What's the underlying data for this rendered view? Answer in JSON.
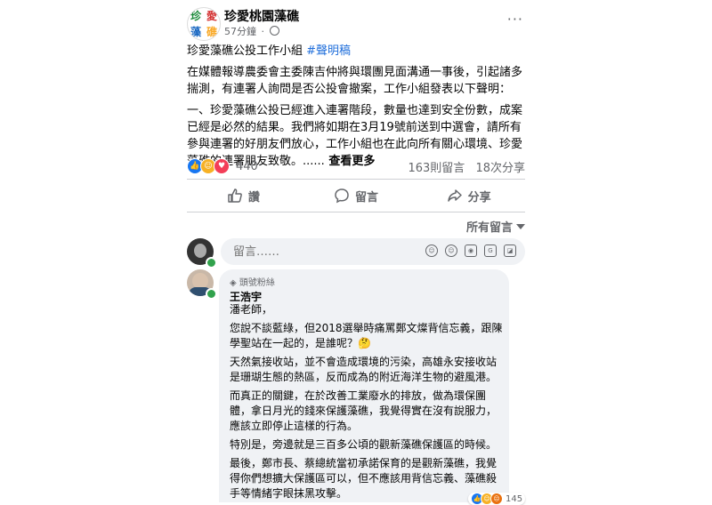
{
  "post": {
    "page_name": "珍愛桃園藻礁",
    "time": "57分鐘",
    "subtitle": "珍愛藻礁公投工作小組 ",
    "hashtag": "#聲明稿",
    "para1": "在媒體報導農委會主委陳吉仲將與環團見面溝通一事後，引起諸多揣測，有連署人詢問是否公投會撤案，工作小組發表以下聲明：",
    "para2": "一、珍愛藻礁公投已經進入連署階段，數量也達到安全份數，成案已經是必然的結果。我們將如期在3月19號前送到中選會，請所有參與連署的好朋友們放心，工作小組也在此向所有關心環境、珍愛藻礁的連署朋友致敬。......",
    "see_more": " 查看更多",
    "reaction_count": "440",
    "comments_count": "163則留言",
    "shares_count": "18次分享"
  },
  "actions": {
    "like": "讚",
    "comment": "留言",
    "share": "分享"
  },
  "sort_label": "所有留言",
  "comment_box": {
    "placeholder": "留言……"
  },
  "comment": {
    "badge": "頭號粉絲",
    "author": "王浩宇",
    "lines": [
      "潘老師，",
      "您說不談藍綠，但2018選舉時痛罵鄭文燦背信忘義，跟陳學聖站在一起的，是誰呢？🤔",
      "天然氣接收站，並不會造成環境的污染，高雄永安接收站是珊瑚生態的熱區，反而成為的附近海洋生物的避風港。",
      "而真正的關鍵，在於改善工業廢水的排放，做為環保團體，拿日月光的錢來保護藻礁，我覺得實在沒有說服力，應該立即停止這樣的行為。",
      "特別是，旁邊就是三百多公頃的觀新藻礁保護區的時候。",
      "最後，鄭市長、蔡總統當初承諾保育的是觀新藻礁，我覺得你們想擴大保護區可以，但不應該用背信忘義、藻礁殺手等情緒字眼抹黑攻擊。"
    ],
    "reaction_count": "145"
  },
  "colors": {
    "like": "#1877f2",
    "love": "#f33e58",
    "care": "#f7b125",
    "link": "#216fdb",
    "muted": "#65676b"
  }
}
